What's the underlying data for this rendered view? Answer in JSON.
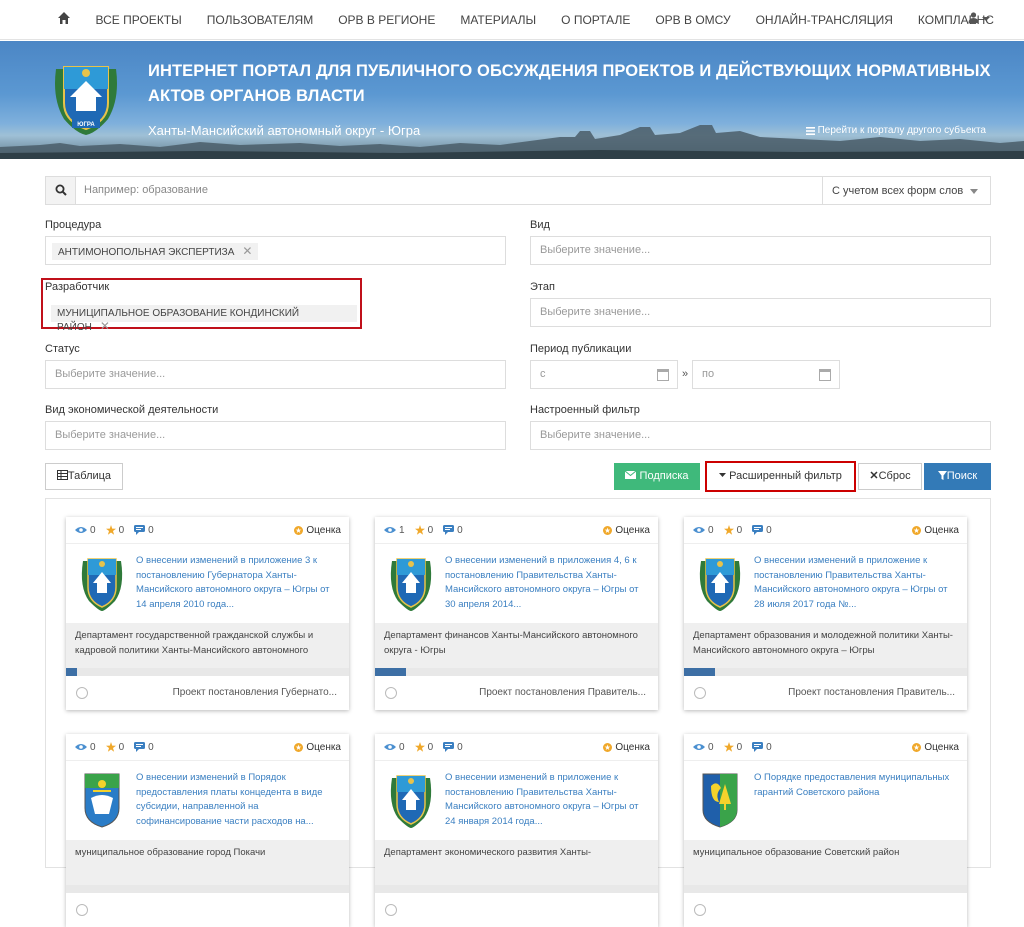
{
  "nav": {
    "items": [
      "ВСЕ ПРОЕКТЫ",
      "ПОЛЬЗОВАТЕЛЯМ",
      "ОРВ В РЕГИОНЕ",
      "МАТЕРИАЛЫ",
      "О ПОРТАЛЕ",
      "ОРВ В ОМСУ",
      "ОНЛАЙН-ТРАНСЛЯЦИЯ",
      "КОМПЛАЕНС"
    ]
  },
  "banner": {
    "title": "ИНТЕРНЕТ ПОРТАЛ ДЛЯ ПУБЛИЧНОГО ОБСУЖДЕНИЯ ПРОЕКТОВ И ДЕЙСТВУЮЩИХ НОРМАТИВНЫХ АКТОВ ОРГАНОВ ВЛАСТИ",
    "region": "Ханты-Мансийский автономный округ - Югра",
    "switch_label": "Перейти к порталу другого субъекта",
    "crest_text": "ЮГРА"
  },
  "search": {
    "placeholder": "Например: образование",
    "mode": "С учетом всех форм слов"
  },
  "filters": {
    "procedure_label": "Процедура",
    "procedure_value": "АНТИМОНОПОЛЬНАЯ ЭКСПЕРТИЗА",
    "kind_label": "Вид",
    "kind_placeholder": "Выберите значение...",
    "developer_label": "Разработчик",
    "developer_value": "МУНИЦИПАЛЬНОЕ ОБРАЗОВАНИЕ КОНДИНСКИЙ РАЙОН",
    "stage_label": "Этап",
    "stage_placeholder": "Выберите значение...",
    "status_label": "Статус",
    "status_placeholder": "Выберите значение...",
    "period_label": "Период публикации",
    "period_from": "с",
    "period_sep": "»",
    "period_to": "по",
    "econ_label": "Вид экономической деятельности",
    "econ_placeholder": "Выберите значение...",
    "custom_label": "Настроенный фильтр",
    "custom_placeholder": "Выберите значение..."
  },
  "toolbar": {
    "table": "Таблица",
    "subscribe": "Подписка",
    "advanced": "Расширенный фильтр",
    "reset": "Сброс",
    "search": "Поиск"
  },
  "cards": [
    {
      "views": "0",
      "stars": "0",
      "comments": "0",
      "rating": "Оценка",
      "emblem": "hmao",
      "title": "О внесении изменений в приложение 3 к постановлению Губернатора Ханты-Мансийского автономного округа – Югры от 14 апреля 2010 года...",
      "dept": "Департамент государственной гражданской службы и кадровой политики Ханты-Мансийского автономного",
      "progress": 0.04,
      "type": "Проект постановления Губернато..."
    },
    {
      "views": "1",
      "stars": "0",
      "comments": "0",
      "rating": "Оценка",
      "emblem": "hmao",
      "title": "О внесении изменений в приложения 4, 6 к постановлению Правительства Ханты-Мансийского автономного округа – Югры от 30 апреля 2014...",
      "dept": "Департамент финансов Ханты-Мансийского автономного округа - Югры",
      "progress": 0.11,
      "type": "Проект постановления Правитель..."
    },
    {
      "views": "0",
      "stars": "0",
      "comments": "0",
      "rating": "Оценка",
      "emblem": "hmao",
      "title": "О внесении изменений в приложение к постановлению Правительства Ханты-Мансийского автономного округа – Югры от 28 июля 2017 года №...",
      "dept": "Департамент образования и молодежной политики Ханты-Мансийского автономного округа – Югры",
      "progress": 0.11,
      "type": "Проект постановления Правитель..."
    },
    {
      "views": "0",
      "stars": "0",
      "comments": "0",
      "rating": "Оценка",
      "emblem": "pokachi",
      "title": "О внесении изменений в Порядок предоставления платы концедента в виде субсидии, направленной на софинансирование части расходов на...",
      "dept": "муниципальное образование город Покачи",
      "progress": 0,
      "type": ""
    },
    {
      "views": "0",
      "stars": "0",
      "comments": "0",
      "rating": "Оценка",
      "emblem": "hmao",
      "title": "О внесении изменений в приложение к постановлению Правительства Ханты-Мансийского автономного округа – Югры от 24 января 2014 года...",
      "dept": "Департамент экономического развития Ханты-",
      "progress": 0,
      "type": ""
    },
    {
      "views": "0",
      "stars": "0",
      "comments": "0",
      "rating": "Оценка",
      "emblem": "sovetsky",
      "title": "О Порядке предоставления муниципальных гарантий Советского района",
      "dept": "муниципальное образование Советский район",
      "progress": 0,
      "type": ""
    }
  ],
  "colors": {
    "accent": "#337ab7",
    "success": "#3fb97b",
    "highlight": "#c0101a",
    "link": "#3a7fc1"
  }
}
